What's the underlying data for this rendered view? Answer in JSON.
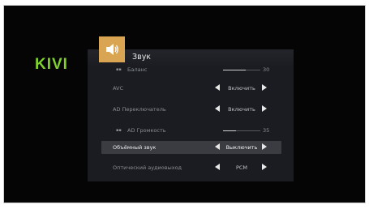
{
  "brand": {
    "logo": "KIVI"
  },
  "menu": {
    "title": "Звук",
    "icon": "speaker-icon",
    "rows": [
      {
        "label": "Баланс",
        "type": "slider",
        "value": "30",
        "level": 0.6
      },
      {
        "label": "AVC",
        "type": "option",
        "value": "Включить"
      },
      {
        "label": "AD Переключатель",
        "type": "option",
        "value": "Включить"
      },
      {
        "label": "AD Громкость",
        "type": "slider",
        "value": "35",
        "level": 0.35
      },
      {
        "label": "Объёмный звук",
        "type": "option",
        "value": "Выключить",
        "selected": true
      },
      {
        "label": "Оптический аудиовыход",
        "type": "option",
        "value": "PCM"
      }
    ]
  },
  "colors": {
    "brand": "#7fd12b",
    "accent": "#d9a552",
    "panel": "#1a1c22",
    "selection": "#3a3c42"
  }
}
